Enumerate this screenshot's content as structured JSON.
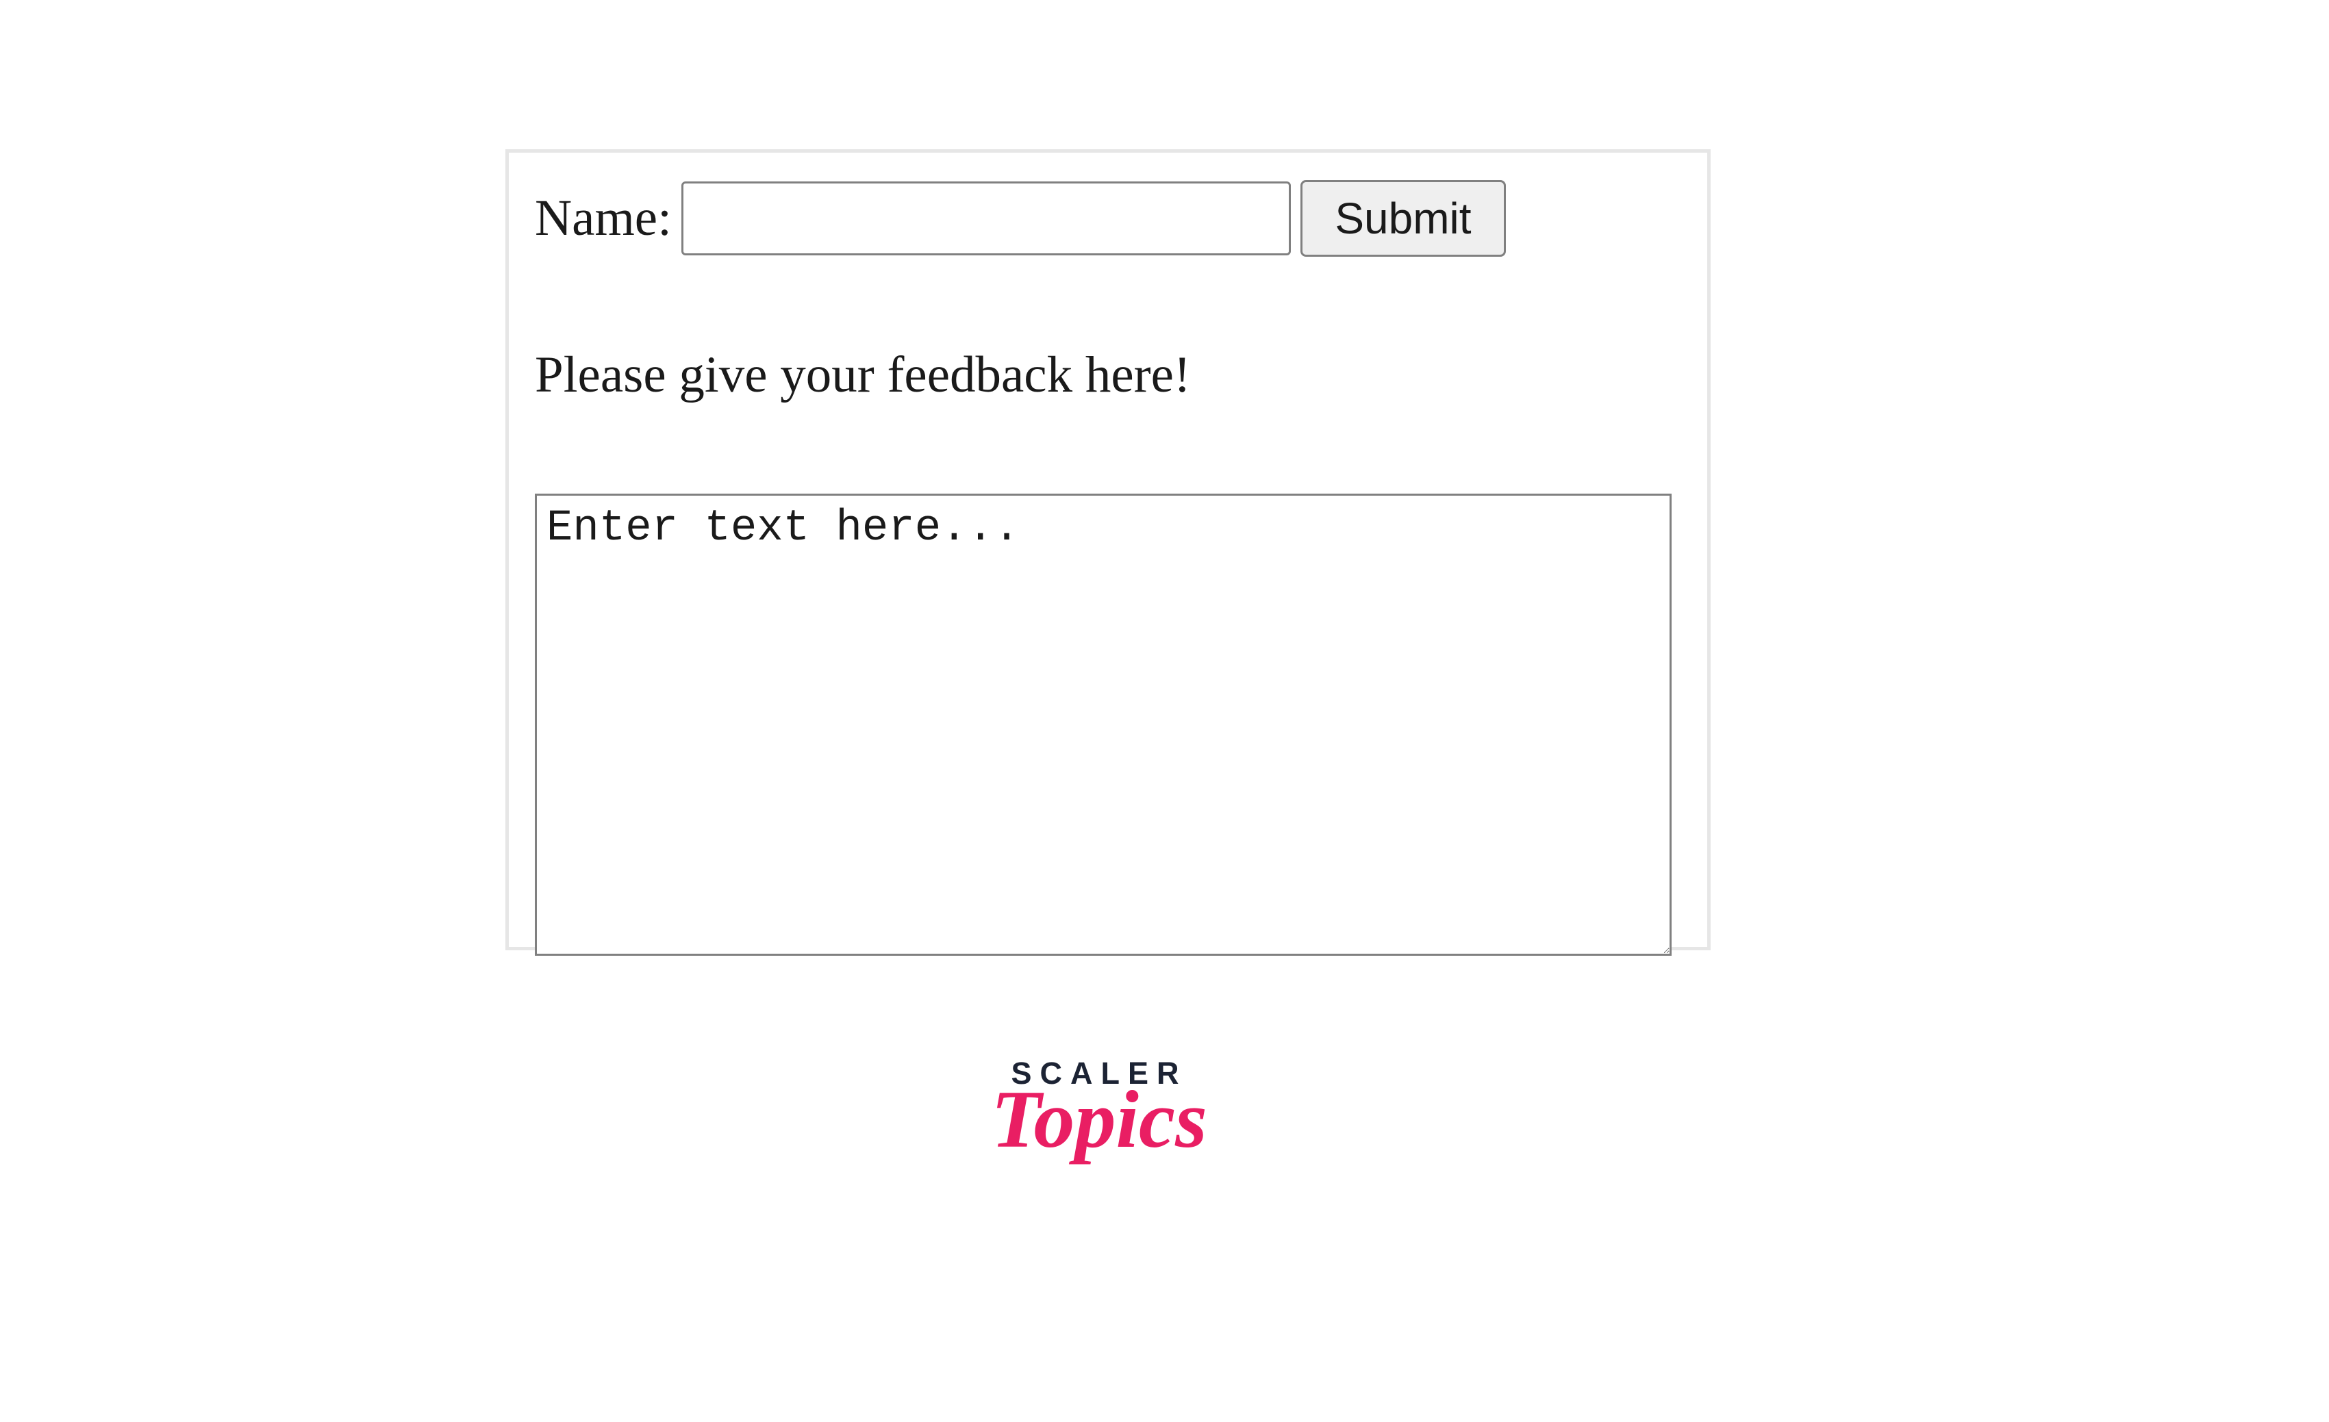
{
  "form": {
    "name_label": "Name:",
    "name_value": "",
    "submit_label": "Submit",
    "feedback_prompt": "Please give your feedback here!",
    "textarea_placeholder": "Enter text here...",
    "textarea_value": ""
  },
  "logo": {
    "line1": "SCALER",
    "line2": "Topics"
  }
}
